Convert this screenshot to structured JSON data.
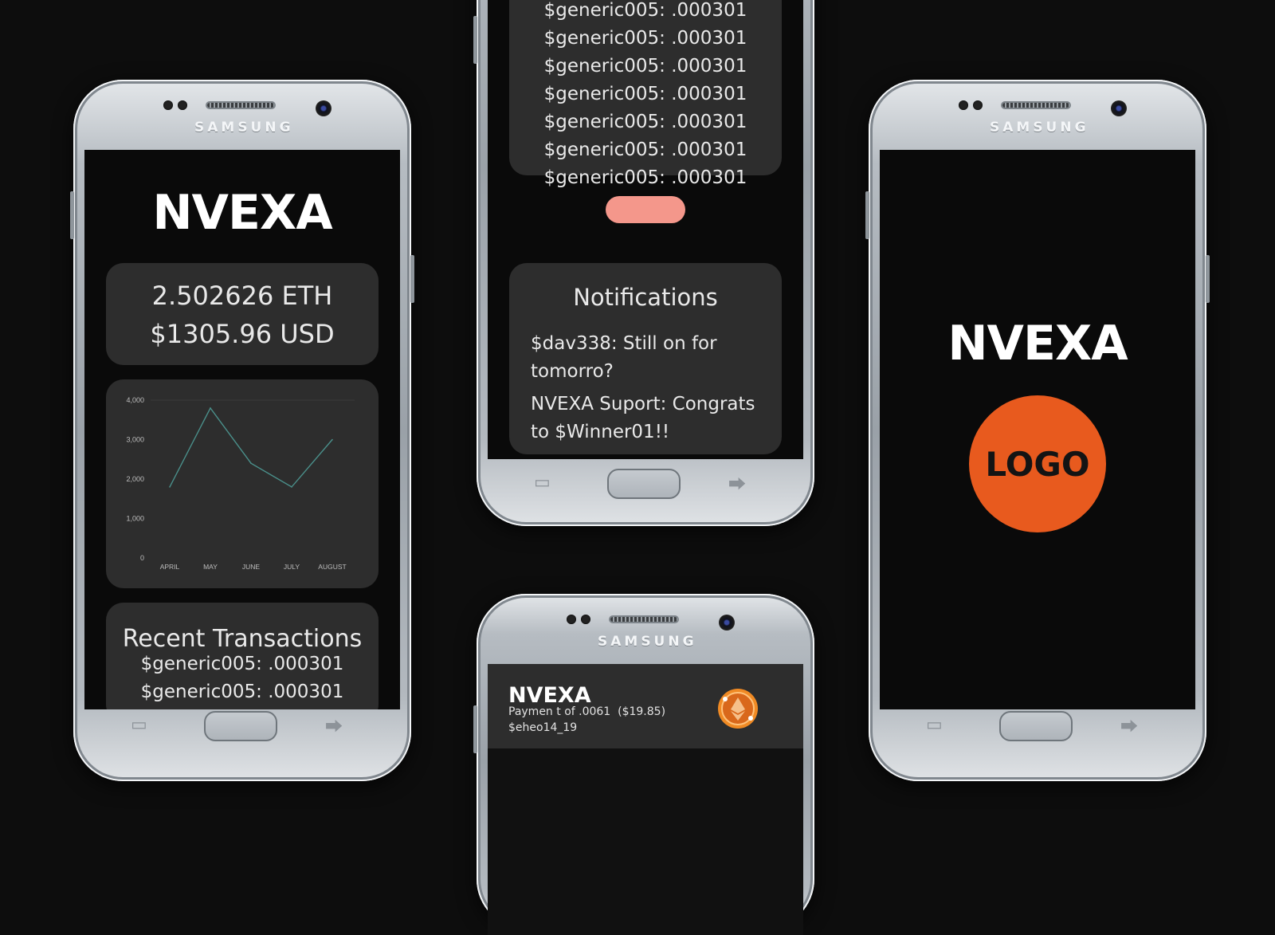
{
  "brand": "SAMSUNG",
  "phone1": {
    "app_title": "NVEXA",
    "balance_eth": "2.502626 ETH",
    "balance_usd": "$1305.96 USD",
    "recent_title": "Recent Transactions",
    "transactions": [
      "$generic005: .000301",
      "$generic005: .000301"
    ]
  },
  "chart_data": {
    "type": "line",
    "categories": [
      "APRIL",
      "MAY",
      "JUNE",
      "JULY",
      "AUGUST"
    ],
    "values": [
      1800,
      3800,
      2400,
      1800,
      3000
    ],
    "yticks": [
      "4,000",
      "3,000",
      "2,000",
      "1,000",
      "0"
    ],
    "ylim": [
      0,
      4000
    ],
    "line_color": "#4a8f8a",
    "title": "",
    "xlabel": "",
    "ylabel": "",
    "grid": false
  },
  "phone2": {
    "transactions": [
      "$generic005: .000301",
      "$generic005: .000301",
      "$generic005: .000301",
      "$generic005: .000301",
      "$generic005: .000301",
      "$generic005: .000301",
      "$generic005: .000301"
    ],
    "button_color": "#f4978b",
    "notifications_title": "Notifications",
    "notifications": [
      "$dav338: Still on for tomorro?",
      "NVEXA Suport: Congrats to $Winner01!!"
    ]
  },
  "phone3": {
    "app_title": "NVEXA",
    "payment_text": "Paymen t of .0061  ($19.85)",
    "payment_user": "$eheo14_19",
    "coin_icon": "ethereum-icon"
  },
  "phone4": {
    "app_title": "NVEXA",
    "logo_text": "LOGO",
    "logo_color": "#e85a1e"
  },
  "colors": {
    "card": "#2d2d2d",
    "screen": "#0a0a0a"
  }
}
